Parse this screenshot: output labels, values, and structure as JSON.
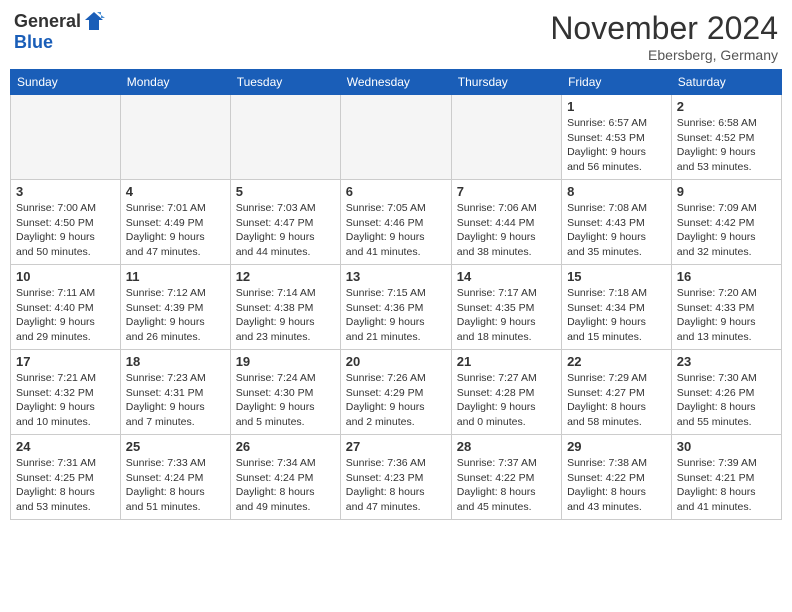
{
  "header": {
    "logo_general": "General",
    "logo_blue": "Blue",
    "title": "November 2024",
    "location": "Ebersberg, Germany"
  },
  "days_of_week": [
    "Sunday",
    "Monday",
    "Tuesday",
    "Wednesday",
    "Thursday",
    "Friday",
    "Saturday"
  ],
  "weeks": [
    [
      {
        "day": "",
        "info": ""
      },
      {
        "day": "",
        "info": ""
      },
      {
        "day": "",
        "info": ""
      },
      {
        "day": "",
        "info": ""
      },
      {
        "day": "",
        "info": ""
      },
      {
        "day": "1",
        "info": "Sunrise: 6:57 AM\nSunset: 4:53 PM\nDaylight: 9 hours\nand 56 minutes."
      },
      {
        "day": "2",
        "info": "Sunrise: 6:58 AM\nSunset: 4:52 PM\nDaylight: 9 hours\nand 53 minutes."
      }
    ],
    [
      {
        "day": "3",
        "info": "Sunrise: 7:00 AM\nSunset: 4:50 PM\nDaylight: 9 hours\nand 50 minutes."
      },
      {
        "day": "4",
        "info": "Sunrise: 7:01 AM\nSunset: 4:49 PM\nDaylight: 9 hours\nand 47 minutes."
      },
      {
        "day": "5",
        "info": "Sunrise: 7:03 AM\nSunset: 4:47 PM\nDaylight: 9 hours\nand 44 minutes."
      },
      {
        "day": "6",
        "info": "Sunrise: 7:05 AM\nSunset: 4:46 PM\nDaylight: 9 hours\nand 41 minutes."
      },
      {
        "day": "7",
        "info": "Sunrise: 7:06 AM\nSunset: 4:44 PM\nDaylight: 9 hours\nand 38 minutes."
      },
      {
        "day": "8",
        "info": "Sunrise: 7:08 AM\nSunset: 4:43 PM\nDaylight: 9 hours\nand 35 minutes."
      },
      {
        "day": "9",
        "info": "Sunrise: 7:09 AM\nSunset: 4:42 PM\nDaylight: 9 hours\nand 32 minutes."
      }
    ],
    [
      {
        "day": "10",
        "info": "Sunrise: 7:11 AM\nSunset: 4:40 PM\nDaylight: 9 hours\nand 29 minutes."
      },
      {
        "day": "11",
        "info": "Sunrise: 7:12 AM\nSunset: 4:39 PM\nDaylight: 9 hours\nand 26 minutes."
      },
      {
        "day": "12",
        "info": "Sunrise: 7:14 AM\nSunset: 4:38 PM\nDaylight: 9 hours\nand 23 minutes."
      },
      {
        "day": "13",
        "info": "Sunrise: 7:15 AM\nSunset: 4:36 PM\nDaylight: 9 hours\nand 21 minutes."
      },
      {
        "day": "14",
        "info": "Sunrise: 7:17 AM\nSunset: 4:35 PM\nDaylight: 9 hours\nand 18 minutes."
      },
      {
        "day": "15",
        "info": "Sunrise: 7:18 AM\nSunset: 4:34 PM\nDaylight: 9 hours\nand 15 minutes."
      },
      {
        "day": "16",
        "info": "Sunrise: 7:20 AM\nSunset: 4:33 PM\nDaylight: 9 hours\nand 13 minutes."
      }
    ],
    [
      {
        "day": "17",
        "info": "Sunrise: 7:21 AM\nSunset: 4:32 PM\nDaylight: 9 hours\nand 10 minutes."
      },
      {
        "day": "18",
        "info": "Sunrise: 7:23 AM\nSunset: 4:31 PM\nDaylight: 9 hours\nand 7 minutes."
      },
      {
        "day": "19",
        "info": "Sunrise: 7:24 AM\nSunset: 4:30 PM\nDaylight: 9 hours\nand 5 minutes."
      },
      {
        "day": "20",
        "info": "Sunrise: 7:26 AM\nSunset: 4:29 PM\nDaylight: 9 hours\nand 2 minutes."
      },
      {
        "day": "21",
        "info": "Sunrise: 7:27 AM\nSunset: 4:28 PM\nDaylight: 9 hours\nand 0 minutes."
      },
      {
        "day": "22",
        "info": "Sunrise: 7:29 AM\nSunset: 4:27 PM\nDaylight: 8 hours\nand 58 minutes."
      },
      {
        "day": "23",
        "info": "Sunrise: 7:30 AM\nSunset: 4:26 PM\nDaylight: 8 hours\nand 55 minutes."
      }
    ],
    [
      {
        "day": "24",
        "info": "Sunrise: 7:31 AM\nSunset: 4:25 PM\nDaylight: 8 hours\nand 53 minutes."
      },
      {
        "day": "25",
        "info": "Sunrise: 7:33 AM\nSunset: 4:24 PM\nDaylight: 8 hours\nand 51 minutes."
      },
      {
        "day": "26",
        "info": "Sunrise: 7:34 AM\nSunset: 4:24 PM\nDaylight: 8 hours\nand 49 minutes."
      },
      {
        "day": "27",
        "info": "Sunrise: 7:36 AM\nSunset: 4:23 PM\nDaylight: 8 hours\nand 47 minutes."
      },
      {
        "day": "28",
        "info": "Sunrise: 7:37 AM\nSunset: 4:22 PM\nDaylight: 8 hours\nand 45 minutes."
      },
      {
        "day": "29",
        "info": "Sunrise: 7:38 AM\nSunset: 4:22 PM\nDaylight: 8 hours\nand 43 minutes."
      },
      {
        "day": "30",
        "info": "Sunrise: 7:39 AM\nSunset: 4:21 PM\nDaylight: 8 hours\nand 41 minutes."
      }
    ]
  ]
}
